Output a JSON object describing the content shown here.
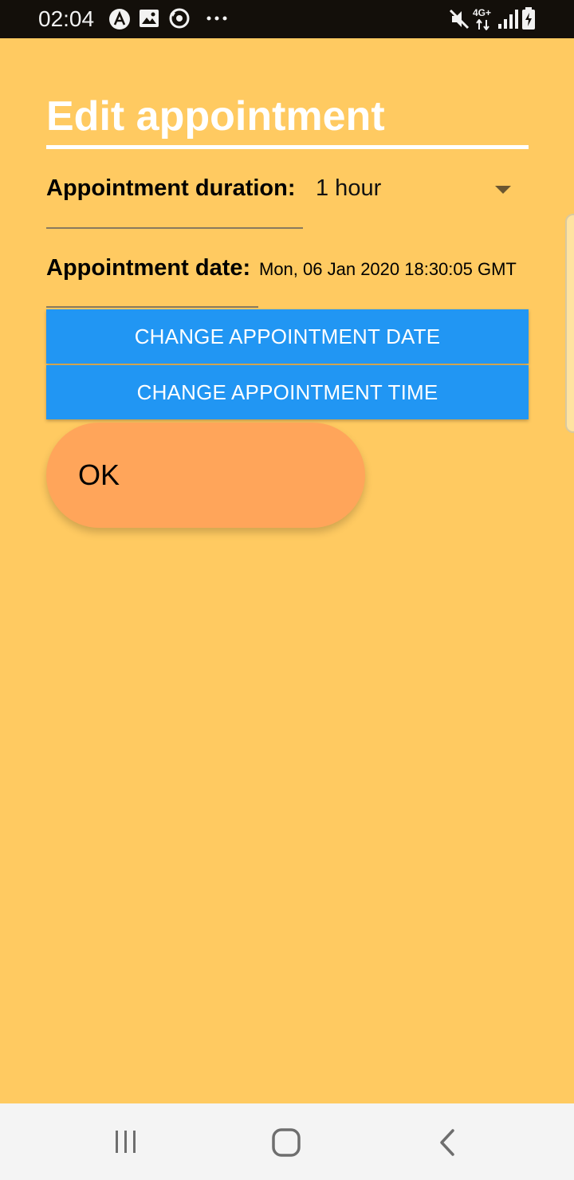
{
  "status_bar": {
    "time": "02:04",
    "icons_left": [
      "a-app-icon",
      "image-icon",
      "sync-icon",
      "more-dots-icon"
    ],
    "network": "4G+",
    "icons_right": [
      "mute-icon",
      "signal-icon",
      "battery-charging-icon"
    ]
  },
  "page": {
    "title": "Edit appointment",
    "duration_label": "Appointment duration:",
    "duration_value": "1 hour",
    "date_label": "Appointment date:",
    "date_value": "Mon, 06 Jan 2020 18:30:05 GMT",
    "change_date_label": "CHANGE APPOINTMENT DATE",
    "change_time_label": "CHANGE APPOINTMENT TIME",
    "ok_label": "OK"
  },
  "nav_bar": {
    "items": [
      "recent-apps-icon",
      "home-icon",
      "back-icon"
    ]
  },
  "colors": {
    "background": "#FFCA61",
    "title": "#FFFFFF",
    "button": "#2196F3",
    "ok_button": "#FFA55A",
    "status_bar": "#130F0A",
    "nav_bar": "#F4F4F4"
  }
}
